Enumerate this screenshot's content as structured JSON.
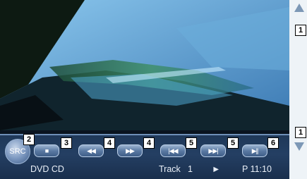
{
  "source_button": "SRC",
  "controls": [
    {
      "name": "stop",
      "glyph": "■",
      "callout": "3"
    },
    {
      "name": "fast-rewind",
      "glyph": "◀◀",
      "callout": "4"
    },
    {
      "name": "fast-forward",
      "glyph": "▶▶",
      "callout": "4"
    },
    {
      "name": "previous-track",
      "glyph": "|◀◀",
      "callout": "5"
    },
    {
      "name": "next-track",
      "glyph": "▶▶|",
      "callout": "5"
    },
    {
      "name": "play-pause",
      "glyph": "▶||",
      "callout": "6"
    }
  ],
  "callouts": {
    "scroll_up": "1",
    "scroll_down": "1",
    "src": "2"
  },
  "status": {
    "media_type": "DVD CD",
    "track_label": "Track",
    "track_number": "1",
    "play_state_glyph": "►",
    "time": "P 11:10"
  },
  "colors": {
    "bar": "#243f63",
    "button": "#5b7aa3",
    "accent": "#7d98b6"
  }
}
